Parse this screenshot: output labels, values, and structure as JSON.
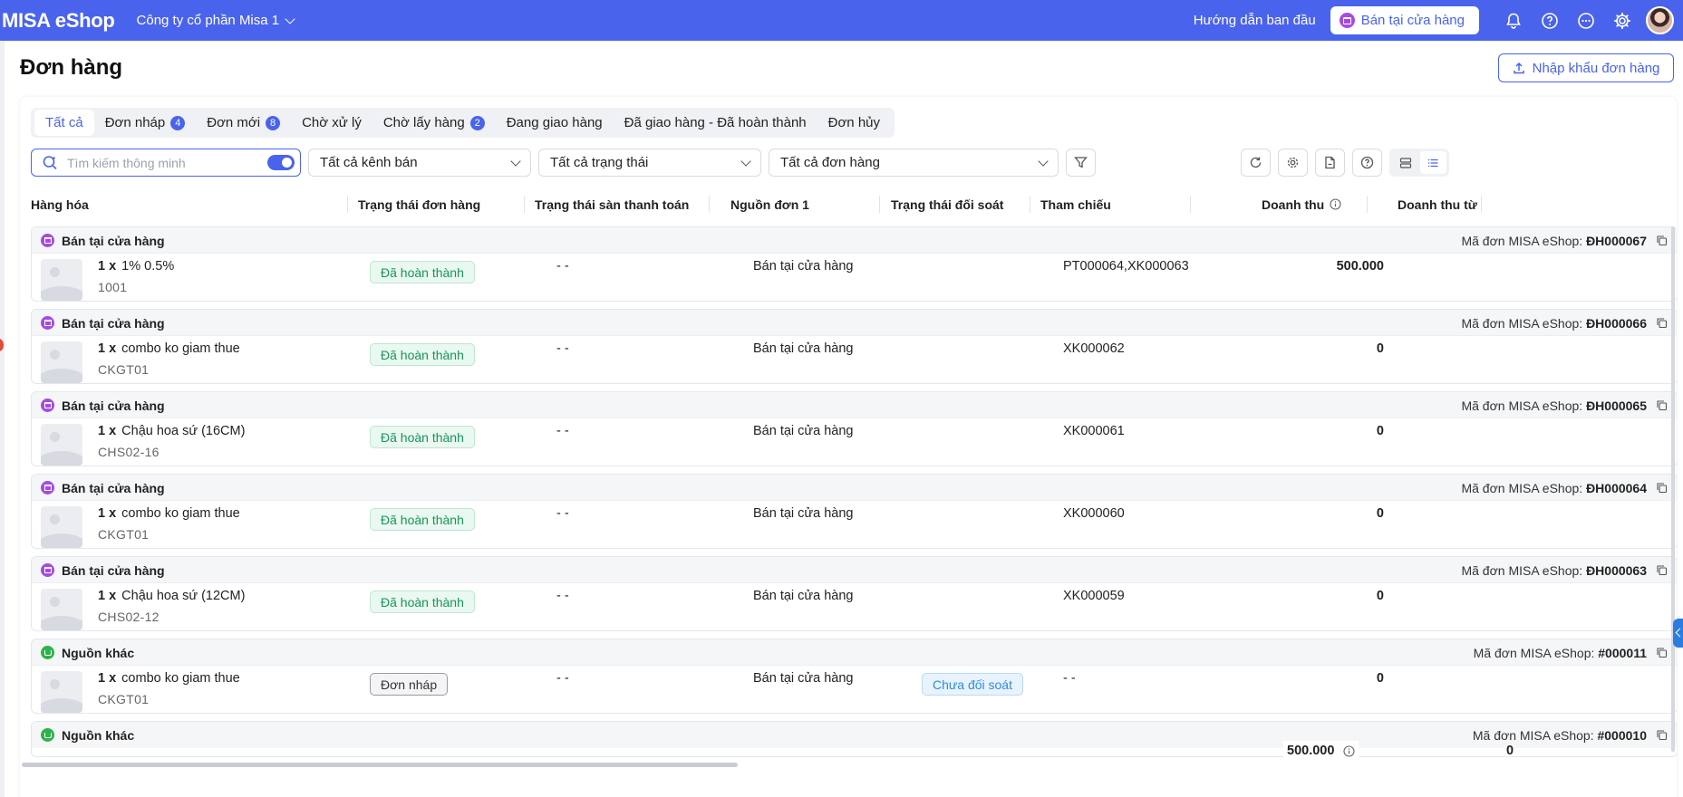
{
  "app": {
    "brand": "MISA eShop",
    "company": "Công ty cổ phần Misa 1",
    "guide": "Hướng dẫn ban đầu",
    "pos_button": "Bán tại cửa hàng"
  },
  "page": {
    "title": "Đơn hàng",
    "import_button": "Nhập khẩu đơn hàng"
  },
  "tabs": [
    {
      "label": "Tất cả",
      "count": ""
    },
    {
      "label": "Đơn nháp",
      "count": "4"
    },
    {
      "label": "Đơn mới",
      "count": "8"
    },
    {
      "label": "Chờ xử lý",
      "count": ""
    },
    {
      "label": "Chờ lấy hàng",
      "count": "2"
    },
    {
      "label": "Đang giao hàng",
      "count": ""
    },
    {
      "label": "Đã giao hàng - Đã hoàn thành",
      "count": ""
    },
    {
      "label": "Đơn hủy",
      "count": ""
    }
  ],
  "filters": {
    "search_placeholder": "Tìm kiếm thông minh",
    "channel": "Tất cả kênh bán",
    "status": "Tất cả trạng thái",
    "orders": "Tất cả đơn hàng"
  },
  "columns": {
    "product": "Hàng hóa",
    "order_status": "Trạng thái đơn hàng",
    "payment_status": "Trạng thái sàn thanh toán",
    "source": "Nguồn đơn 1",
    "reconcile": "Trạng thái đối soát",
    "reference": "Tham chiếu",
    "revenue": "Doanh thu",
    "revenue_from": "Doanh thu từ"
  },
  "groups": [
    {
      "source": "Bán tại cửa hàng",
      "code_label": "Mã đơn MISA eShop:",
      "code": "ĐH000067",
      "qty": "1 x",
      "product": "1% 0.5%",
      "sku": "1001",
      "status": "Đã hoàn thành",
      "payment": "- -",
      "order_source": "Bán tại cửa hàng",
      "reconcile": "",
      "reference": "PT000064,XK000063",
      "revenue": "500.000"
    },
    {
      "source": "Bán tại cửa hàng",
      "code_label": "Mã đơn MISA eShop:",
      "code": "ĐH000066",
      "qty": "1 x",
      "product": "combo ko giam thue",
      "sku": "CKGT01",
      "status": "Đã hoàn thành",
      "payment": "- -",
      "order_source": "Bán tại cửa hàng",
      "reconcile": "",
      "reference": "XK000062",
      "revenue": "0"
    },
    {
      "source": "Bán tại cửa hàng",
      "code_label": "Mã đơn MISA eShop:",
      "code": "ĐH000065",
      "qty": "1 x",
      "product": "Chậu hoa sứ (16CM)",
      "sku": "CHS02-16",
      "status": "Đã hoàn thành",
      "payment": "- -",
      "order_source": "Bán tại cửa hàng",
      "reconcile": "",
      "reference": "XK000061",
      "revenue": "0"
    },
    {
      "source": "Bán tại cửa hàng",
      "code_label": "Mã đơn MISA eShop:",
      "code": "ĐH000064",
      "qty": "1 x",
      "product": "combo ko giam thue",
      "sku": "CKGT01",
      "status": "Đã hoàn thành",
      "payment": "- -",
      "order_source": "Bán tại cửa hàng",
      "reconcile": "",
      "reference": "XK000060",
      "revenue": "0"
    },
    {
      "source": "Bán tại cửa hàng",
      "code_label": "Mã đơn MISA eShop:",
      "code": "ĐH000063",
      "qty": "1 x",
      "product": "Chậu hoa sứ (12CM)",
      "sku": "CHS02-12",
      "status": "Đã hoàn thành",
      "payment": "- -",
      "order_source": "Bán tại cửa hàng",
      "reconcile": "",
      "reference": "XK000059",
      "revenue": "0"
    },
    {
      "source": "Nguồn khác",
      "code_label": "Mã đơn MISA eShop:",
      "code": "#000011",
      "qty": "1 x",
      "product": "combo ko giam thue",
      "sku": "CKGT01",
      "status": "Đơn nháp",
      "payment": "- -",
      "order_source": "Bán tại cửa hàng",
      "reconcile": "Chưa đối soát",
      "reference": "- -",
      "revenue": "0"
    },
    {
      "source": "Nguồn khác",
      "code_label": "Mã đơn MISA eShop:",
      "code": "#000010"
    }
  ],
  "totals": {
    "revenue": "500.000",
    "revenue_from": "0"
  }
}
